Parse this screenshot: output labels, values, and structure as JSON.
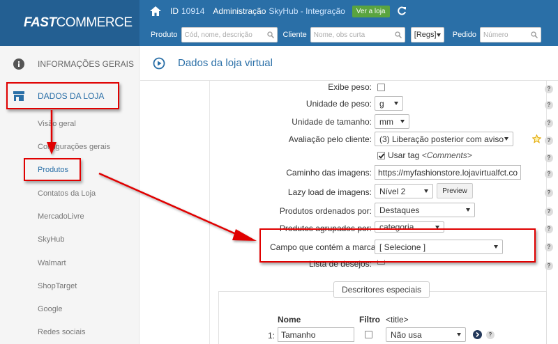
{
  "header": {
    "logo_bold": "FAST",
    "logo_rest": "COMMERCE",
    "id_label": "ID",
    "id_value": "10914",
    "admin_label": "Administração",
    "store_name": "SkyHub - Integração",
    "view_store_label": "Ver a loja",
    "search": {
      "produto_label": "Produto",
      "produto_placeholder": "Cód, nome, descrição",
      "cliente_label": "Cliente",
      "cliente_placeholder": "Nome, obs curta",
      "regs_value": "[Regs]",
      "pedido_label": "Pedido",
      "pedido_placeholder": "Número"
    }
  },
  "sidebar": {
    "sections": [
      {
        "label": "INFORMAÇÕES GERAIS",
        "icon": "info-icon"
      },
      {
        "label": "DADOS DA LOJA",
        "icon": "store-icon"
      }
    ],
    "items": [
      {
        "label": "Visão geral"
      },
      {
        "label": "Configurações gerais"
      },
      {
        "label": "Produtos"
      },
      {
        "label": "Contatos da Loja"
      },
      {
        "label": "MercadoLivre"
      },
      {
        "label": "SkyHub"
      },
      {
        "label": "Walmart"
      },
      {
        "label": "ShopTarget"
      },
      {
        "label": "Google"
      },
      {
        "label": "Redes sociais"
      }
    ]
  },
  "main": {
    "title": "Dados da loja virtual",
    "fields": {
      "exibe_peso": "Exibe peso:",
      "unidade_peso": "Unidade de peso:",
      "unidade_peso_value": "g",
      "unidade_tamanho": "Unidade de tamanho:",
      "unidade_tamanho_value": "mm",
      "avaliacao": "Avaliação pelo cliente:",
      "avaliacao_value": "(3) Liberação posterior com aviso",
      "usar_tag": "Usar tag",
      "usar_tag_code": "<Comments>",
      "caminho": "Caminho das imagens:",
      "caminho_value": "https://myfashionstore.lojavirtualfct.co",
      "lazy": "Lazy load de imagens:",
      "lazy_value": "Nível 2",
      "preview_label": "Preview",
      "ordenados": "Produtos ordenados por:",
      "ordenados_value": "Destaques",
      "agrupados": "Produtos agrupados por:",
      "agrupados_value": "categoria",
      "campo_marca": "Campo que contém a marca:",
      "campo_marca_value": "[ Selecione ]",
      "lista_desejos": "Lista de desejos:"
    },
    "descritores": {
      "title": "Descritores especiais",
      "col_nome": "Nome",
      "col_filtro": "Filtro",
      "col_title": "<title>",
      "row_index": "1:",
      "row_nome": "Tamanho",
      "row_title_value": "Não usa"
    }
  },
  "colors": {
    "header_bg": "#2a6fa7",
    "logo_bg": "#235f92",
    "accent_green": "#5aa43f",
    "annotation_red": "#e00000"
  }
}
